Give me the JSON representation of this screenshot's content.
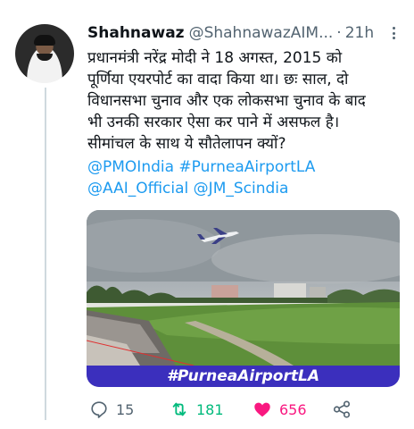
{
  "tweet": {
    "author_name": "Shahnawaz",
    "author_handle": "@ShahnawazAIM...",
    "separator": "·",
    "time": "21h",
    "text": "प्रधानमंत्री नरेंद्र मोदी ने 18 अगस्त, 2015 को\nपूर्णिया एयरपोर्ट का वादा किया था। छः साल, दो\nविधानसभा चुनाव और एक लोकसभा चुनाव के बाद\nभी उनकी सरकार ऐसा कर पाने में असफल है।\nसीमांचल के साथ ये सौतेलापन क्यों?",
    "links": [
      "@PMOIndia #PurneaAirportLA",
      "@AAI_Official @JM_Scindia"
    ],
    "media_caption": "#PurneaAirportLA",
    "actions": {
      "reply_count": "15",
      "retweet_count": "181",
      "like_count": "656"
    }
  },
  "icons": [
    "avatar",
    "more-icon",
    "reply-icon",
    "retweet-icon",
    "heart-icon",
    "share-icon"
  ],
  "colors": {
    "link": "#1d9bf0",
    "retweeted": "#00ba7c",
    "liked": "#f91880",
    "secondary_text": "#536471",
    "caption_banner": "#3b2fbd"
  }
}
